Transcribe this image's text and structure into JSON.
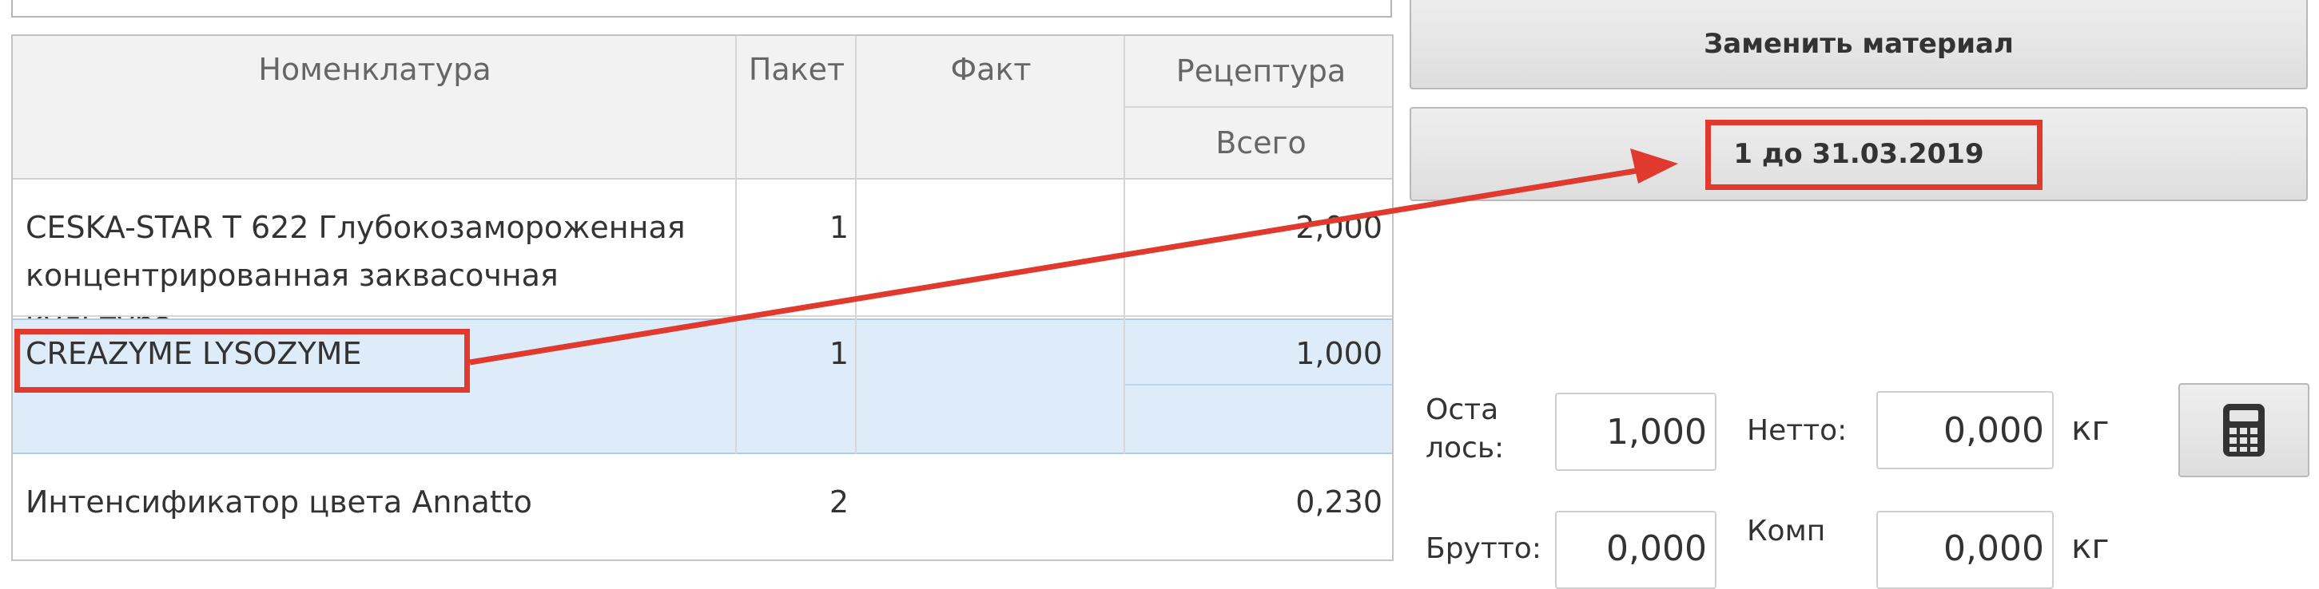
{
  "grid": {
    "headers": {
      "nomenclature": "Номенклатура",
      "packet": "Пакет",
      "fact": "Факт",
      "recipe": "Рецептура",
      "recipe_total": "Всего"
    },
    "rows": [
      {
        "name_line1": "CESKA-STAR T 622 Глубокозамороженная",
        "name_line2": "концентрированная заквасочная культура",
        "packet": "1",
        "total": "2,000"
      },
      {
        "name_line1": "CREAZYME LYSOZYME",
        "name_line2": "",
        "packet": "1",
        "total": "1,000"
      },
      {
        "name_line1": "Интенсификатор цвета Annatto",
        "name_line2": "",
        "packet": "2",
        "total": "0,230"
      }
    ]
  },
  "actions": {
    "replace_material": "Заменить материал",
    "batch": "1 до 31.03.2019"
  },
  "weights": {
    "remaining_label_line1": "Оста",
    "remaining_label_line2": "лось:",
    "remaining_value": "1,000",
    "net_label": "Нетто:",
    "net_value": "0,000",
    "net_unit": "кг",
    "gross_label": "Брутто:",
    "gross_value": "0,000",
    "comp_label": "Комп",
    "comp_value": "0,000",
    "comp_unit": "кг"
  },
  "icons": {
    "calculator": "calculator-icon"
  },
  "colors": {
    "annotation": "#e03a2f",
    "selected_row": "#deecfa",
    "header_bg": "#f2f2f2"
  }
}
